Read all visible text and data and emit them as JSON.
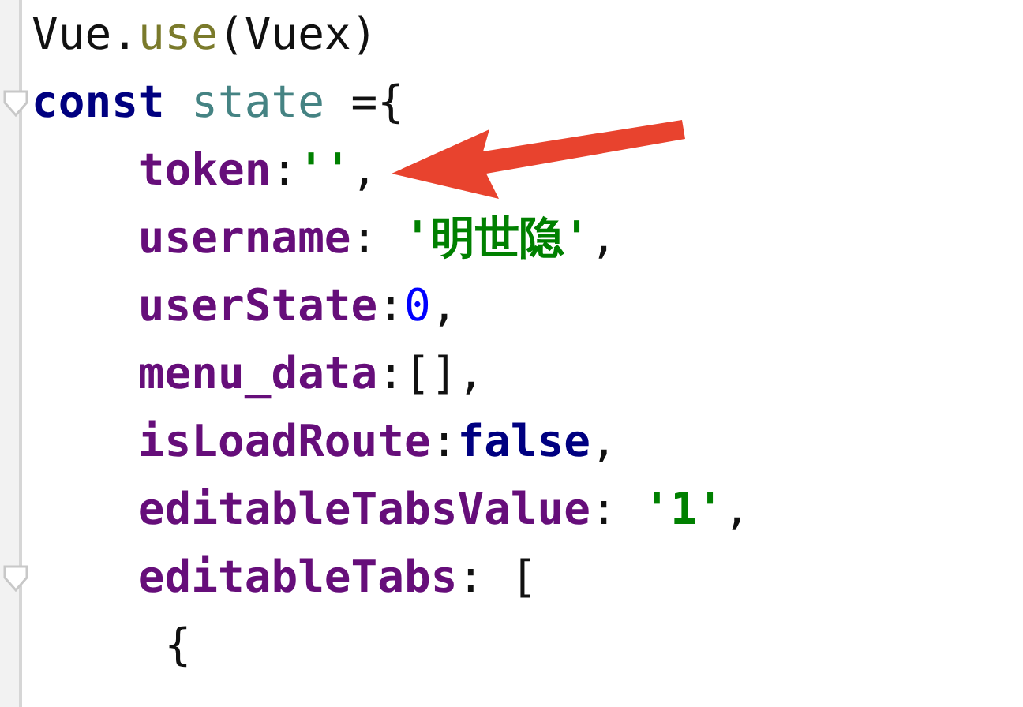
{
  "editor": {
    "lines": [
      {
        "kind": "top",
        "foldable": false,
        "tokens": [
          {
            "kind": "plain",
            "text": "Vue."
          },
          {
            "kind": "method",
            "text": "use"
          },
          {
            "kind": "plain",
            "text": "(Vuex)"
          }
        ]
      },
      {
        "kind": "top",
        "foldable": true,
        "tokens": [
          {
            "kind": "keyword",
            "text": "const"
          },
          {
            "kind": "variable",
            "text": "state"
          },
          {
            "kind": "plain",
            "text": " ={"
          }
        ]
      },
      {
        "kind": "member",
        "foldable": false,
        "tokens": [
          {
            "kind": "field",
            "text": "token"
          },
          {
            "kind": "plain",
            "text": ":"
          },
          {
            "kind": "string",
            "text": "''"
          },
          {
            "kind": "plain",
            "text": ","
          }
        ]
      },
      {
        "kind": "member",
        "foldable": false,
        "tokens": [
          {
            "kind": "field",
            "text": "username"
          },
          {
            "kind": "plain",
            "text": ": "
          },
          {
            "kind": "string",
            "text": "'明世隐'"
          },
          {
            "kind": "plain",
            "text": ","
          }
        ]
      },
      {
        "kind": "member",
        "foldable": false,
        "tokens": [
          {
            "kind": "field",
            "text": "userState"
          },
          {
            "kind": "plain",
            "text": ":"
          },
          {
            "kind": "number",
            "text": "0"
          },
          {
            "kind": "plain",
            "text": ","
          }
        ]
      },
      {
        "kind": "member",
        "foldable": false,
        "tokens": [
          {
            "kind": "field",
            "text": "menu_data"
          },
          {
            "kind": "plain",
            "text": ":[],"
          }
        ]
      },
      {
        "kind": "member",
        "foldable": false,
        "tokens": [
          {
            "kind": "field",
            "text": "isLoadRoute"
          },
          {
            "kind": "plain",
            "text": ":"
          },
          {
            "kind": "boolean",
            "text": "false"
          },
          {
            "kind": "plain",
            "text": ","
          }
        ]
      },
      {
        "kind": "member",
        "foldable": false,
        "tokens": [
          {
            "kind": "field",
            "text": "editableTabsValue"
          },
          {
            "kind": "plain",
            "text": ": "
          },
          {
            "kind": "string",
            "text": "'1'"
          },
          {
            "kind": "plain",
            "text": ","
          }
        ]
      },
      {
        "kind": "member",
        "foldable": true,
        "tokens": [
          {
            "kind": "field",
            "text": "editableTabs"
          },
          {
            "kind": "plain",
            "text": ": ["
          }
        ]
      },
      {
        "kind": "nested",
        "foldable": false,
        "tokens": [
          {
            "kind": "plain",
            "text": "{"
          }
        ]
      }
    ]
  }
}
